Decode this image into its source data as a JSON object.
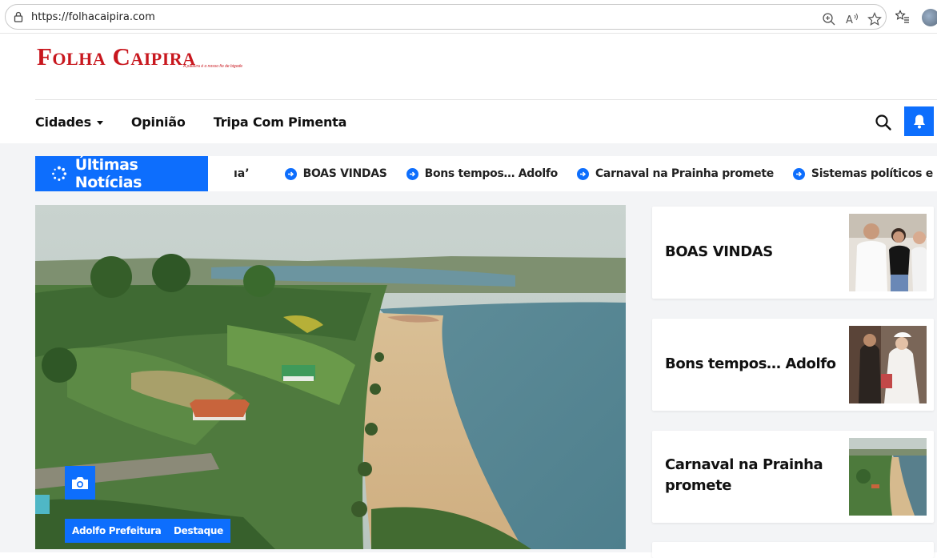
{
  "browser": {
    "url": "https://folhacaipira.com"
  },
  "site": {
    "logo": "Folha Caipira",
    "tagline": "A palavra é o nosso fio de bigode"
  },
  "nav": {
    "items": [
      {
        "label": "Cidades",
        "has_dropdown": true
      },
      {
        "label": "Opinião"
      },
      {
        "label": "Tripa Com Pimenta"
      }
    ]
  },
  "ticker": {
    "label": "Últimas Notícias",
    "fragment": "ıa’",
    "items": [
      "BOAS VINDAS",
      "Bons tempos… Adolfo",
      "Carnaval na Prainha promete",
      "Sistemas políticos e peneiras jurídicas"
    ]
  },
  "featured": {
    "tags": [
      "Adolfo Prefeitura",
      "Destaque"
    ]
  },
  "sidebar": {
    "cards": [
      {
        "title": "BOAS VINDAS"
      },
      {
        "title": "Bons tempos… Adolfo"
      },
      {
        "title": "Carnaval na Prainha promete"
      }
    ]
  },
  "colors": {
    "accent": "#0d6efd",
    "brand": "#c8171e",
    "background": "#f3f4f6"
  },
  "icons": [
    "lock-icon",
    "zoom-icon",
    "read-aloud-icon",
    "favorite-star-icon",
    "favorites-list-icon",
    "search-icon",
    "bell-icon",
    "loader-icon",
    "arrow-right-circle-icon",
    "camera-icon"
  ]
}
